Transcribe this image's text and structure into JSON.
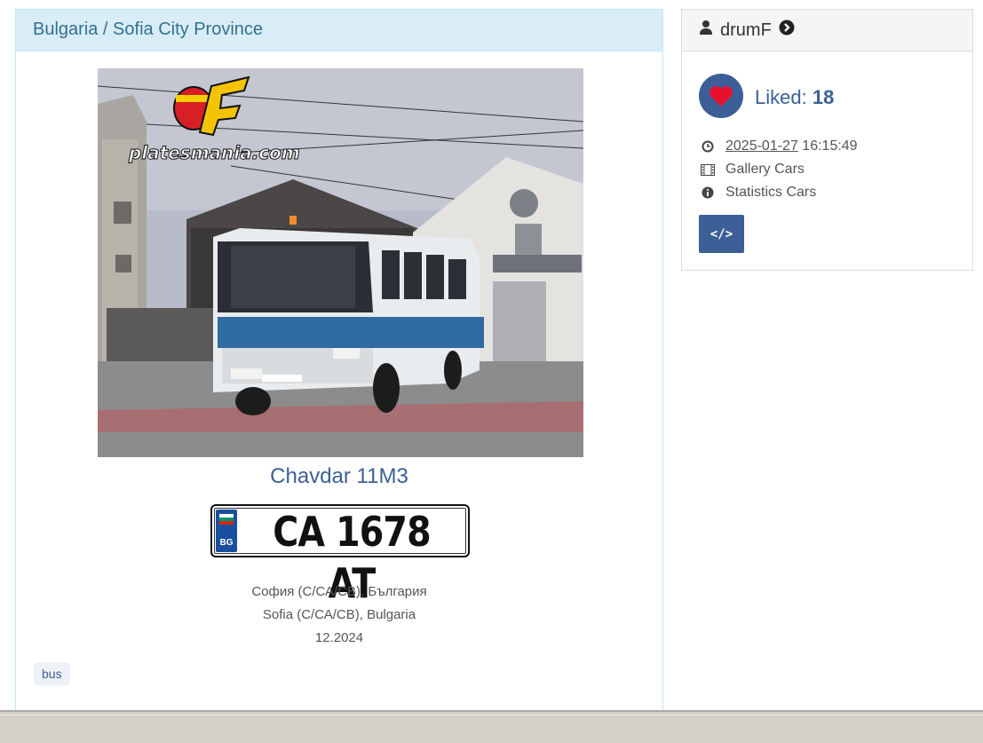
{
  "location_header": "Bulgaria / Sofia City Province",
  "photo": {
    "watermark": "platesmania.com",
    "alt": "bus photo"
  },
  "car_title": "Chavdar 11M3",
  "plate": {
    "number": "CA 1678 AT",
    "country_code": "BG"
  },
  "location_lines": [
    "София (С/СА/СВ), България",
    "Sofia (С/СА/СВ), Bulgaria",
    "12.2024"
  ],
  "tags": [
    "bus"
  ],
  "sidebar": {
    "username": "drumF",
    "liked_label": "Liked:",
    "liked_count": "18",
    "date": "2025-01-27",
    "time": "16:15:49",
    "gallery_link": "Gallery Cars",
    "statistics_link": "Statistics Cars",
    "code_button": "</>"
  },
  "colors": {
    "accent": "#3b5f96",
    "heart": "#e8112d",
    "info_heading_bg": "#d9edf7"
  }
}
